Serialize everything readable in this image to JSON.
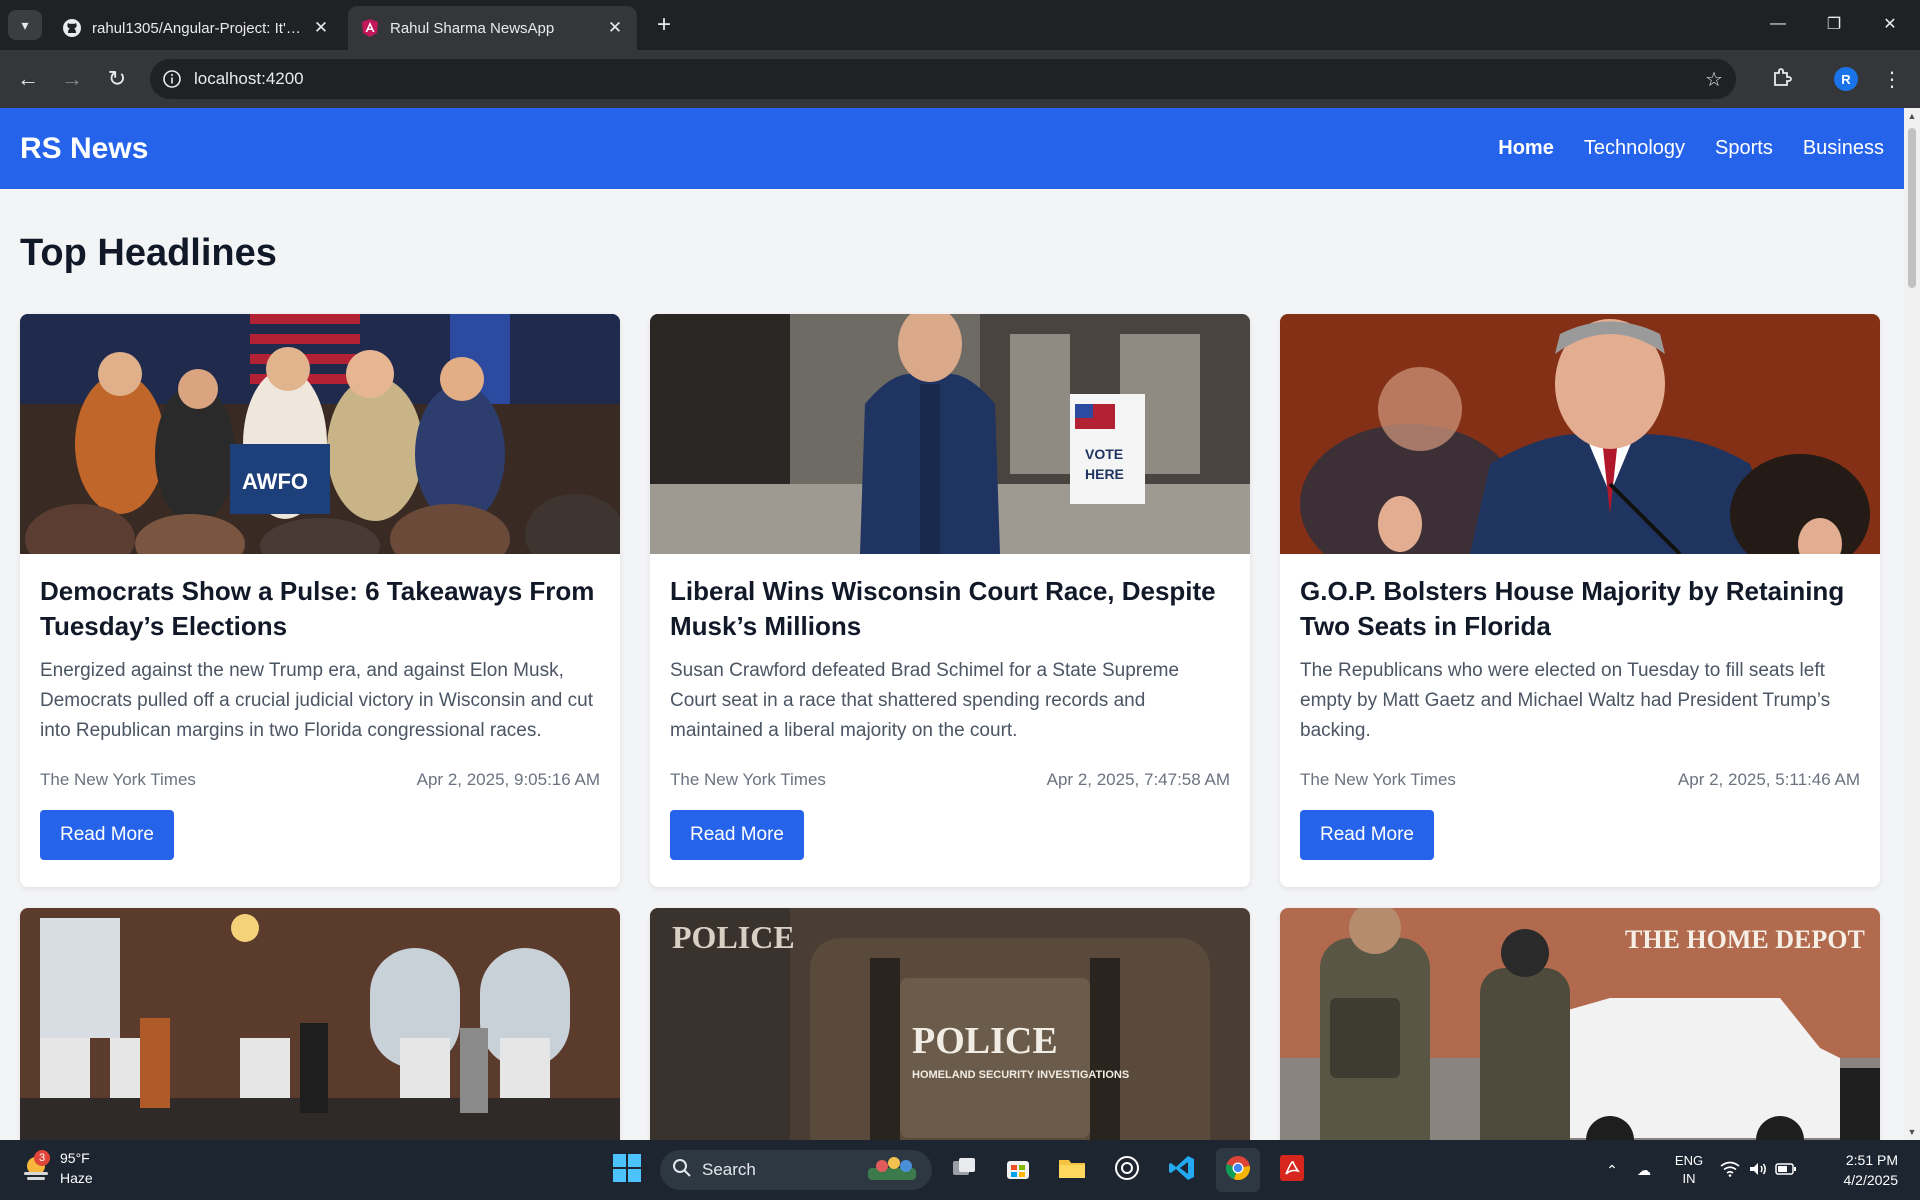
{
  "browser": {
    "tabs": [
      {
        "title": "rahul1305/Angular-Project: It's a",
        "active": false,
        "icon": "github-icon"
      },
      {
        "title": "Rahul Sharma NewsApp",
        "active": true,
        "icon": "angular-icon"
      }
    ],
    "url": "localhost:4200",
    "profile_initial": "R"
  },
  "app": {
    "brand": "RS News",
    "nav": [
      "Home",
      "Technology",
      "Sports",
      "Business"
    ],
    "active_nav": "Home",
    "heading": "Top Headlines",
    "accent_color": "#2563eb",
    "articles": [
      {
        "title": "Democrats Show a Pulse: 6 Takeaways From Tuesday’s Elections",
        "description": "Energized against the new Trump era, and against Elon Musk, Democrats pulled off a crucial judicial victory in Wisconsin and cut into Republican margins in two Florida congressional races.",
        "source": "The New York Times",
        "date": "Apr 2, 2025, 9:05:16 AM",
        "cta": "Read More",
        "image": "election-rally-photo"
      },
      {
        "title": "Liberal Wins Wisconsin Court Race, Despite Musk’s Millions",
        "description": "Susan Crawford defeated Brad Schimel for a State Supreme Court seat in a race that shattered spending records and maintained a liberal majority on the court.",
        "source": "The New York Times",
        "date": "Apr 2, 2025, 7:47:58 AM",
        "cta": "Read More",
        "image": "voter-outside-poll-photo"
      },
      {
        "title": "G.O.P. Bolsters House Majority by Retaining Two Seats in Florida",
        "description": "The Republicans who were elected on Tuesday to fill seats left empty by Matt Gaetz and Michael Waltz had President Trump’s backing.",
        "source": "The New York Times",
        "date": "Apr 2, 2025, 5:11:46 AM",
        "cta": "Read More",
        "image": "politician-speaking-photo"
      },
      {
        "image": "polling-station-photo"
      },
      {
        "image": "police-vest-photo",
        "image_text": "POLICE",
        "image_subtext": "HOMELAND SECURITY INVESTIGATIONS"
      },
      {
        "image": "agents-home-depot-photo",
        "image_text": "THE HOME DEPOT"
      }
    ]
  },
  "taskbar": {
    "weather_temp": "95°F",
    "weather_desc": "Haze",
    "weather_badge": "3",
    "search_placeholder": "Search",
    "lang_top": "ENG",
    "lang_bottom": "IN",
    "time": "2:51 PM",
    "date": "4/2/2025"
  }
}
